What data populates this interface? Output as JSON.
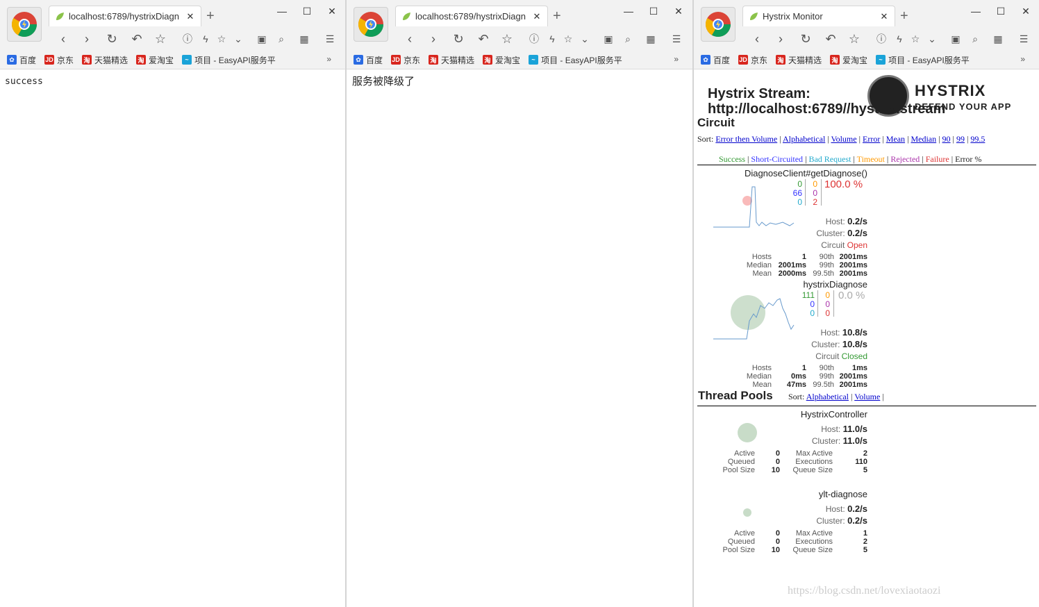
{
  "windows": [
    {
      "tab_title": "localhost:6789/hystrixDiagn",
      "content": "success"
    },
    {
      "tab_title": "localhost:6789/hystrixDiagn",
      "content": "服务被降级了"
    },
    {
      "tab_title": "Hystrix Monitor"
    }
  ],
  "bookmarks": [
    {
      "label": "百度",
      "icon": "baidu-paw-icon",
      "color": "#2a6be3"
    },
    {
      "label": "京东",
      "icon": "jd-logo-icon",
      "color": "#d8261e"
    },
    {
      "label": "天猫精选",
      "icon": "tmall-icon",
      "color": "#d8261e"
    },
    {
      "label": "爱淘宝",
      "icon": "taobao-icon",
      "color": "#d8261e"
    },
    {
      "label": "项目 - EasyAPI服务平",
      "icon": "easyapi-icon",
      "color": "#1aa3d8"
    }
  ],
  "hystrix": {
    "stream_label": "Hystrix Stream:",
    "stream_url": "http://localhost:6789//hystrix.stream",
    "brand": "HYSTRIX",
    "brand_sub": "DEFEND YOUR APP",
    "circuit_heading": "Circuit",
    "sort_label": "Sort:",
    "sort_options": [
      "Error then Volume",
      "Alphabetical",
      "Volume",
      "Error",
      "Mean",
      "Median",
      "90",
      "99",
      "99.5"
    ],
    "legend": [
      "Success",
      "Short-Circuited",
      "Bad Request",
      "Timeout",
      "Rejected",
      "Failure",
      "Error %"
    ],
    "circuits": [
      {
        "name": "DiagnoseClient#getDiagnose()",
        "success": "0",
        "short_circuited": "66",
        "bad_request": "0",
        "timeout": "0",
        "rejected": "0",
        "failure": "2",
        "error_pct": "100.0 %",
        "host_rate_label": "Host:",
        "host_rate": "0.2/s",
        "cluster_rate_label": "Cluster:",
        "cluster_rate": "0.2/s",
        "circuit_label": "Circuit",
        "circuit_status": "Open",
        "hosts": "1",
        "median": "2001ms",
        "mean": "2000ms",
        "p90": "2001ms",
        "p99": "2001ms",
        "p995": "2001ms"
      },
      {
        "name": "hystrixDiagnose",
        "success": "111",
        "short_circuited": "0",
        "bad_request": "0",
        "timeout": "0",
        "rejected": "0",
        "failure": "0",
        "error_pct": "0.0 %",
        "host_rate_label": "Host:",
        "host_rate": "10.8/s",
        "cluster_rate_label": "Cluster:",
        "cluster_rate": "10.8/s",
        "circuit_label": "Circuit",
        "circuit_status": "Closed",
        "hosts": "1",
        "median": "0ms",
        "mean": "47ms",
        "p90": "1ms",
        "p99": "2001ms",
        "p995": "2001ms"
      }
    ],
    "stat_labels": {
      "hosts": "Hosts",
      "median": "Median",
      "mean": "Mean",
      "p90": "90th",
      "p99": "99th",
      "p995": "99.5th"
    },
    "thread_pools_heading": "Thread Pools",
    "pool_sort_options": [
      "Alphabetical",
      "Volume"
    ],
    "pool_labels": {
      "active": "Active",
      "queued": "Queued",
      "pool_size": "Pool Size",
      "max_active": "Max Active",
      "executions": "Executions",
      "queue_size": "Queue Size"
    },
    "pools": [
      {
        "name": "HystrixController",
        "host_rate": "11.0/s",
        "cluster_rate": "11.0/s",
        "active": "0",
        "queued": "0",
        "pool_size": "10",
        "max_active": "2",
        "executions": "110",
        "queue_size": "5"
      },
      {
        "name": "ylt-diagnose",
        "host_rate": "0.2/s",
        "cluster_rate": "0.2/s",
        "active": "0",
        "queued": "0",
        "pool_size": "10",
        "max_active": "1",
        "executions": "2",
        "queue_size": "5"
      }
    ],
    "watermark": "https://blog.csdn.net/lovexiaotaozi"
  }
}
